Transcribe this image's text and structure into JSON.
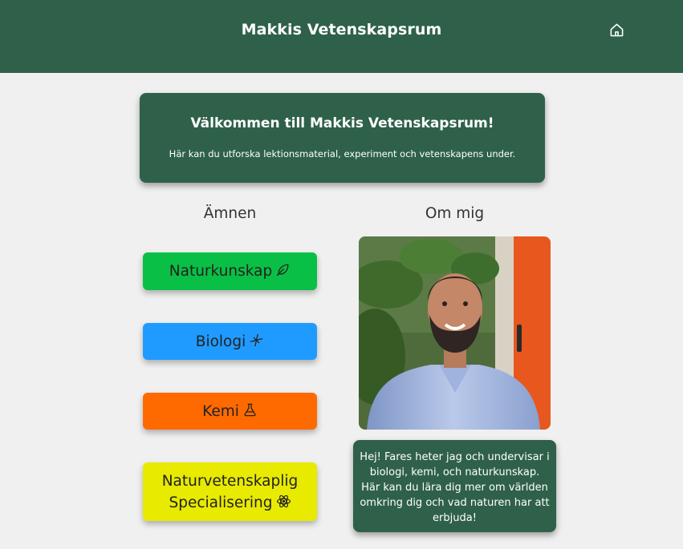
{
  "header": {
    "title": "Makkis Vetenskapsrum",
    "home_icon": "home-icon",
    "background": "#2f614a"
  },
  "welcome": {
    "title": "Välkommen till Makkis Vetenskapsrum!",
    "text": "Här kan du utforska lektionsmaterial, experiment och vetenskapens under."
  },
  "subjects": {
    "heading": "Ämnen",
    "items": [
      {
        "label": "Naturkunskap",
        "icon": "leaf-icon",
        "color": "#0abf45"
      },
      {
        "label": "Biologi",
        "icon": "dna-icon",
        "color": "#1f9bff"
      },
      {
        "label": "Kemi",
        "icon": "flask-icon",
        "color": "#ff6a00"
      },
      {
        "label_line1": "Naturvetenskaplig",
        "label_line2": "Specialisering",
        "icon": "atom-icon",
        "color": "#e8ea00"
      }
    ]
  },
  "about": {
    "heading": "Om mig",
    "photo": "portrait-photo",
    "text": "Hej! Fares heter jag och undervisar i biologi, kemi, och naturkunskap. Här kan du lära dig mer om världen omkring dig och vad naturen har att erbjuda!"
  }
}
